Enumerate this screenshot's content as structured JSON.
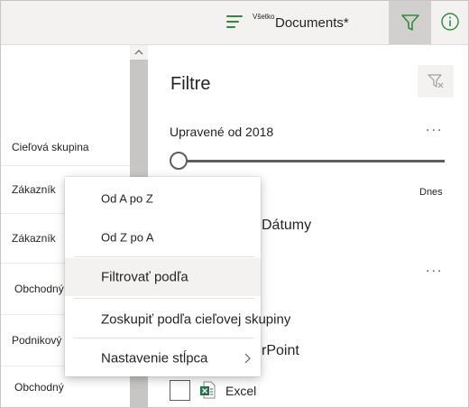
{
  "header": {
    "view_prefix": "Všetko",
    "view_name": "Documents*",
    "view_icon": "list-view-icon",
    "filter_icon": "filter-icon",
    "info_icon": "info-icon"
  },
  "list": {
    "column_header": "Cieľová skupina",
    "rows": [
      "Zákazník",
      "Zákazník",
      "Obchodný",
      "Podnikový",
      "Obchodný"
    ]
  },
  "filter_pane": {
    "title": "Filtre",
    "clear_icon": "clear-filter-icon",
    "modified_title": "Upravené od 2018",
    "more_label": "...",
    "slider_end_label": "Dnes",
    "dates_label": "Dátumy",
    "file_type_partial": "rPoint",
    "excel_label": "Excel",
    "excel_checked": false
  },
  "context_menu": {
    "items": [
      {
        "label": "Od A po Z"
      },
      {
        "label": "Od Z po A"
      },
      {
        "label": "Filtrovať podľa"
      },
      {
        "label": "Zoskupiť podľa cieľovej skupiny"
      },
      {
        "label": "Nastavenie stĺpca"
      }
    ]
  },
  "colors": {
    "accent_green": "#2f8a3f",
    "excel_green": "#217346",
    "topbar_bg": "#f3f2f1",
    "selected_bg": "#d2d0ce"
  }
}
